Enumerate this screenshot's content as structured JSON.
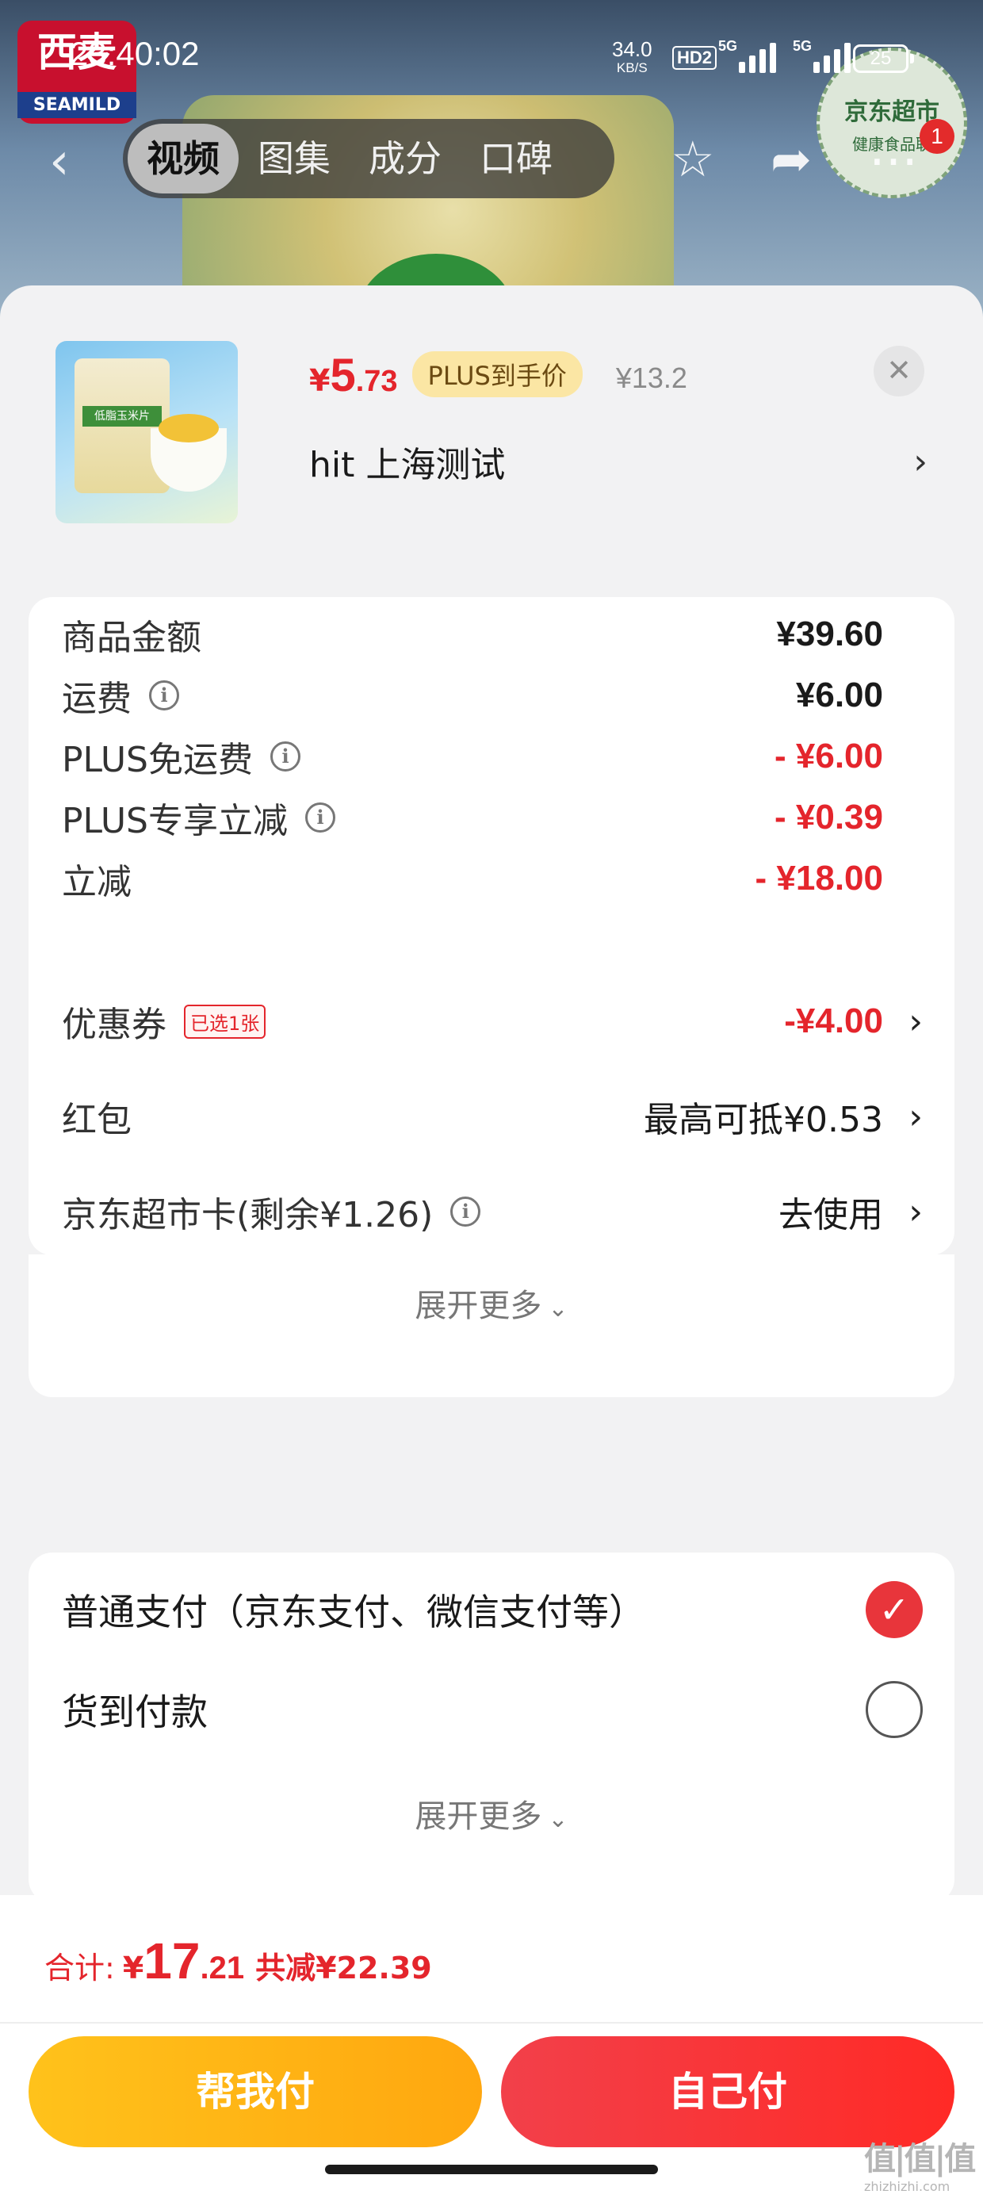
{
  "status_bar": {
    "time": "23:40:02",
    "net_speed": "34.0",
    "net_unit": "KB/S",
    "hd": "HD2",
    "signal1_label": "5G",
    "signal2_label": "5G",
    "battery": "25"
  },
  "background": {
    "brand_cn": "西麦",
    "brand_en": "SEAMILD",
    "seal_title": "京东超市",
    "seal_sub": "健康食品联"
  },
  "nav": {
    "tabs": [
      "视频",
      "图集",
      "成分",
      "口碑"
    ],
    "active_tab": 0,
    "cart_badge": "1"
  },
  "product": {
    "currency": "¥",
    "price_int": "5",
    "price_dec": ".73",
    "plus_tag": "PLUS到手价",
    "orig_price": "¥13.2",
    "pack_label": "低脂玉米片",
    "address": "hit  上海测试"
  },
  "fees": {
    "rows": [
      {
        "label": "商品金额",
        "value": "¥39.60",
        "style": "normal",
        "info": false
      },
      {
        "label": "运费",
        "value": "¥6.00",
        "style": "normal",
        "info": true
      },
      {
        "label": "PLUS免运费",
        "value": "- ¥6.00",
        "style": "red",
        "info": true
      },
      {
        "label": "PLUS专享立减",
        "value": "- ¥0.39",
        "style": "red",
        "info": true
      },
      {
        "label": "立减",
        "value": "- ¥18.00",
        "style": "red",
        "info": false
      },
      {
        "label": "优惠券",
        "tag": "已选1张",
        "value": "-¥4.00",
        "style": "red",
        "info": false
      },
      {
        "label": "红包",
        "value": "最高可抵¥0.53",
        "style": "plain",
        "info": false
      },
      {
        "label": "京东超市卡(剩余¥1.26)",
        "value": "去使用",
        "style": "plain-normal",
        "info": true
      }
    ],
    "expand_label": "展开更多"
  },
  "payment": {
    "options": [
      {
        "label": "普通支付（京东支付、微信支付等）",
        "selected": true
      },
      {
        "label": "货到付款",
        "selected": false
      }
    ],
    "expand_label": "展开更多"
  },
  "footer": {
    "total_label": "合计:",
    "total_currency": "¥",
    "total_int": "17",
    "total_dec": ".21",
    "total_saved": "共减¥22.39",
    "help_pay": "帮我付",
    "self_pay": "自己付",
    "watermark": "值|值|值",
    "watermark_url": "zhizhizhi.com"
  },
  "colors": {
    "accent_red": "#e4252c",
    "help_yellow": "#ffb215",
    "plus_gold": "#fbe6a4"
  }
}
